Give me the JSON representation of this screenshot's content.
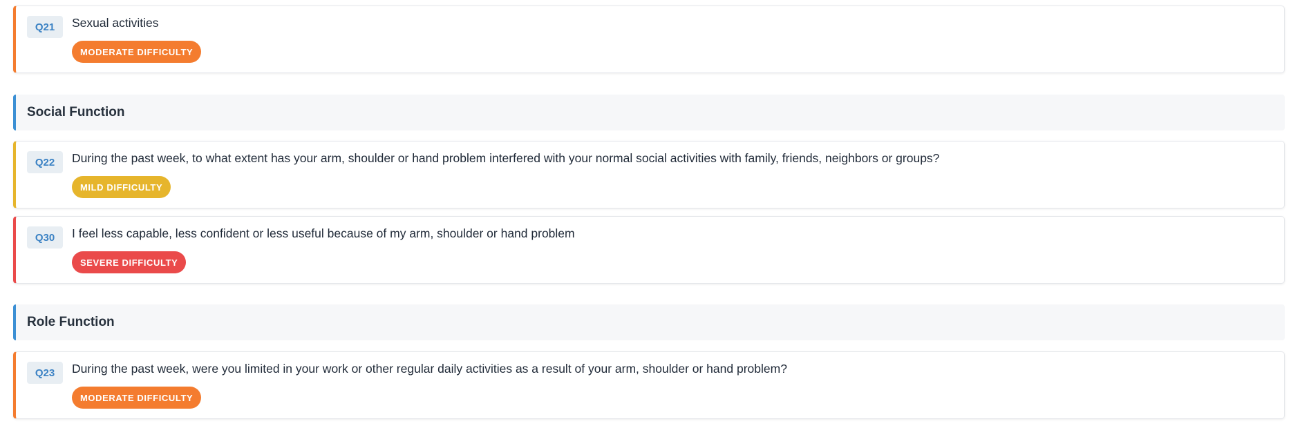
{
  "colors": {
    "moderate": "#f47c2f",
    "mild": "#e6b52c",
    "severe": "#ea4a4a",
    "section_accent": "#3b8fd4",
    "qnum_bg": "#e8eef3",
    "qnum_text": "#3b82c4"
  },
  "items": [
    {
      "qnum": "Q21",
      "text": "Sexual activities",
      "badge": "MODERATE DIFFICULTY",
      "severity": "moderate"
    },
    {
      "qnum": "Q22",
      "text": "During the past week, to what extent has your arm, shoulder or hand problem interfered with your normal social activities with family, friends, neighbors or groups?",
      "badge": "MILD DIFFICULTY",
      "severity": "mild"
    },
    {
      "qnum": "Q30",
      "text": "I feel less capable, less confident or less useful because of my arm, shoulder or hand problem",
      "badge": "SEVERE DIFFICULTY",
      "severity": "severe"
    },
    {
      "qnum": "Q23",
      "text": "During the past week, were you limited in your work or other regular daily activities as a result of your arm, shoulder or hand problem?",
      "badge": "MODERATE DIFFICULTY",
      "severity": "moderate"
    }
  ],
  "sections": [
    {
      "title": "Social Function"
    },
    {
      "title": "Role Function"
    }
  ]
}
